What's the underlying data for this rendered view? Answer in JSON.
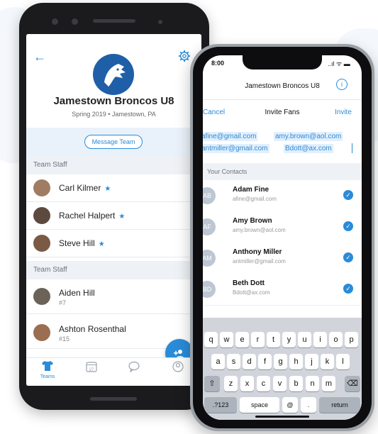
{
  "android": {
    "team_name": "Jamestown Broncos U8",
    "team_sub": "Spring 2019 • Jamestown, PA",
    "message_button": "Message Team",
    "section1": "Team Staff",
    "staff": [
      {
        "name": "Carl Kilmer"
      },
      {
        "name": "Rachel Halpert"
      },
      {
        "name": "Steve Hill"
      }
    ],
    "section2": "Team Staff",
    "players": [
      {
        "name": "Aiden Hill",
        "number": "#7"
      },
      {
        "name": "Ashton Rosenthal",
        "number": "#15"
      }
    ],
    "tabs": {
      "teams": "Teams",
      "calendar_day": "27"
    }
  },
  "iphone": {
    "time": "8:00",
    "status": "..ıl ᯤ ▬",
    "title": "Jamestown Broncos U8",
    "cancel": "Cancel",
    "nav_title": "Invite Fans",
    "invite": "Invite",
    "emails": [
      "afine@gmail.com",
      "amy.brown@aol.com",
      "antmiller@gmail.com",
      "Bdott@ax.com"
    ],
    "contacts_header": "Your Contacts",
    "contacts": [
      {
        "initials": "AB",
        "name": "Adam Fine",
        "email": "afine@gmail.com"
      },
      {
        "initials": "AF",
        "name": "Amy Brown",
        "email": "amy.brown@aol.com"
      },
      {
        "initials": "AM",
        "name": "Anthony Miller",
        "email": "antmiller@gmail.com"
      },
      {
        "initials": "BD",
        "name": "Beth Dott",
        "email": "Bdott@ax.com"
      }
    ],
    "keyboard": {
      "row1": [
        "q",
        "w",
        "e",
        "r",
        "t",
        "y",
        "u",
        "i",
        "o",
        "p"
      ],
      "row2": [
        "a",
        "s",
        "d",
        "f",
        "g",
        "h",
        "j",
        "k",
        "l"
      ],
      "row3": [
        "z",
        "x",
        "c",
        "v",
        "b",
        "n",
        "m"
      ],
      "k123": ".?123",
      "space": "space",
      "at": "@",
      "dot": ".",
      "return": "return"
    }
  },
  "colors": {
    "accent": "#2a8bd8",
    "section_bg": "#eef1f5"
  }
}
